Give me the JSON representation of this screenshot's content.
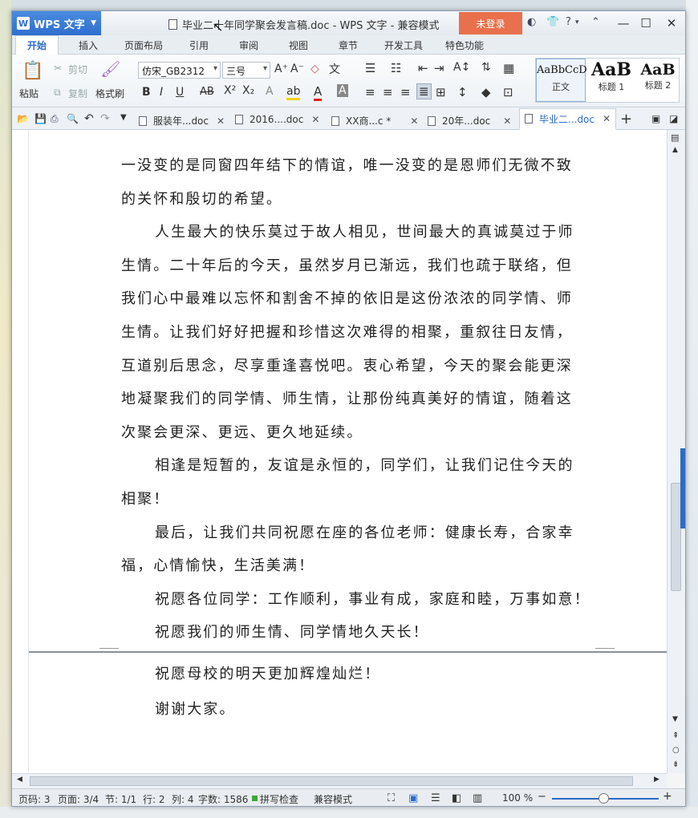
{
  "app": {
    "name": "WPS 文字",
    "logo": "W",
    "title": "毕业二十年同学聚会发言稿.doc - WPS 文字 - 兼容模式",
    "login": "未登录"
  },
  "window_controls": {
    "help": "?"
  },
  "menu_tabs": [
    "开始",
    "插入",
    "页面布局",
    "引用",
    "审阅",
    "视图",
    "章节",
    "开发工具",
    "特色功能"
  ],
  "ribbon": {
    "paste": "粘贴",
    "cut": "剪切",
    "copy": "复制",
    "format_painter": "格式刷",
    "font": "仿宋_GB2312",
    "size": "三号",
    "styles": [
      {
        "sample": "AaBbCcD",
        "label": "正文"
      },
      {
        "sample": "AaB",
        "label": "标题 1"
      },
      {
        "sample": "AaB",
        "label": "标题 2"
      }
    ]
  },
  "doc_tabs": [
    {
      "label": "服装年...doc",
      "active": false
    },
    {
      "label": "2016....doc",
      "active": false
    },
    {
      "label": "XX商...c *",
      "active": false
    },
    {
      "label": "20年...doc",
      "active": false
    },
    {
      "label": "毕业二...doc",
      "active": true
    }
  ],
  "document": {
    "page1_lines": [
      {
        "text": "一没变的是同窗四年结下的情谊，唯一没变的是恩师们无微不致",
        "indent": false
      },
      {
        "text": "的关怀和殷切的希望。",
        "indent": false
      },
      {
        "text": "人生最大的快乐莫过于故人相见，世间最大的真诚莫过于师",
        "indent": true
      },
      {
        "text": "生情。二十年后的今天，虽然岁月已渐远，我们也疏于联络，但",
        "indent": false
      },
      {
        "text": "我们心中最难以忘怀和割舍不掉的依旧是这份浓浓的同学情、师",
        "indent": false
      },
      {
        "text": "生情。让我们好好把握和珍惜这次难得的相聚，重叙往日友情，",
        "indent": false
      },
      {
        "text": "互道别后思念，尽享重逢喜悦吧。衷心希望，今天的聚会能更深",
        "indent": false
      },
      {
        "text": "地凝聚我们的同学情、师生情，让那份纯真美好的情谊，随着这",
        "indent": false
      },
      {
        "text": "次聚会更深、更远、更久地延续。",
        "indent": false
      },
      {
        "text": "相逢是短暂的，友谊是永恒的，同学们，让我们记住今天的",
        "indent": true
      },
      {
        "text": "相聚！",
        "indent": false
      },
      {
        "text": "最后，让我们共同祝愿在座的各位老师：健康长寿，合家幸",
        "indent": true
      },
      {
        "text": "福，心情愉快，生活美满！",
        "indent": false
      },
      {
        "text": "祝愿各位同学：工作顺利，事业有成，家庭和睦，万事如意！",
        "indent": true
      },
      {
        "text": "祝愿我们的师生情、同学情地久天长！",
        "indent": true
      }
    ],
    "page2_lines": [
      {
        "text": "祝愿母校的明天更加辉煌灿烂！",
        "indent": true
      },
      {
        "text": "谢谢大家。",
        "indent": true
      }
    ]
  },
  "status": {
    "page_code": "页码: 3",
    "pages": "页面: 3/4",
    "section": "节: 1/1",
    "row": "行: 2",
    "col": "列: 4",
    "word_count": "字数: 1586",
    "spell_check": "拼写检查",
    "mode": "兼容模式",
    "zoom": "100 %",
    "zoom_level": 0.5
  },
  "colors": {
    "accent": "#2e6bc4",
    "login": "#e8704c"
  }
}
